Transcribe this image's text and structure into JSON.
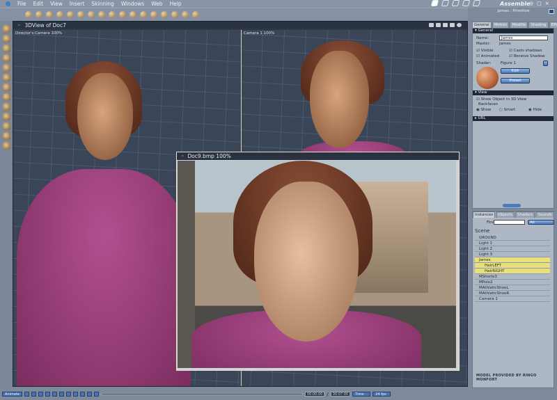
{
  "menu": [
    "File",
    "Edit",
    "View",
    "Insert",
    "Skinning",
    "Windows",
    "Web",
    "Help"
  ],
  "room": "Assemble",
  "window_controls": [
    "◎",
    "□",
    "×"
  ],
  "view3d": {
    "title": "3DView of Doc7",
    "left_label": "Director's Camera 100%",
    "right_label": "Camera 1 100%"
  },
  "doc9": {
    "title": "Doc9.bmp 100%"
  },
  "panel": {
    "title": "James : Primitive",
    "tabs": [
      "General",
      "Motion",
      "Modifie",
      "Shading",
      "Effects"
    ],
    "general_header": "General",
    "name_label": "Name:",
    "name_value": "James",
    "master_label": "Master:",
    "master_value": "James",
    "visible": "Visible",
    "animated": "Animated",
    "casts_shadows": "Casts shadows",
    "receive_shadow": "Receive Shadow",
    "shader_label": "Shader:",
    "shader_value": "Figure 1",
    "edit": "Edit",
    "preset": "Preset",
    "view_header": "View",
    "show_object": "Show Object in 3D View",
    "backfaces": "Backfaces",
    "show": "Show",
    "smart": "Smart",
    "hide": "Hide",
    "url_header": "URL"
  },
  "instances": {
    "tabs": [
      "Instances",
      "Objects",
      "Shaders",
      "Sounds"
    ],
    "find_label": "Find:",
    "find_value": "",
    "filter": "All",
    "scene": "Scene",
    "items": [
      {
        "label": "GROUND",
        "selected": false,
        "child": false
      },
      {
        "label": "Light 1",
        "selected": false,
        "child": false
      },
      {
        "label": "Light 2",
        "selected": false,
        "child": false
      },
      {
        "label": "Light 3",
        "selected": false,
        "child": false
      },
      {
        "label": "James",
        "selected": true,
        "child": false
      },
      {
        "label": "HairLEFT",
        "selected": true,
        "child": true
      },
      {
        "label": "HairRIGHT",
        "selected": true,
        "child": true
      },
      {
        "label": "MShorts3",
        "selected": false,
        "child": false
      },
      {
        "label": "MPolo2",
        "selected": false,
        "child": false
      },
      {
        "label": "MAthleticShoeL",
        "selected": false,
        "child": false
      },
      {
        "label": "MAthleticShoeR",
        "selected": false,
        "child": false
      },
      {
        "label": "Camera 1",
        "selected": false,
        "child": false
      }
    ],
    "credit": "MODEL PROVIDED BY RINGO MONFORT"
  },
  "bottom": {
    "animate": "Animate",
    "time_current": "00:00:00",
    "time_end": "00:07:00",
    "sep": "/",
    "time_mode": "Time",
    "fps": "24 fps"
  }
}
